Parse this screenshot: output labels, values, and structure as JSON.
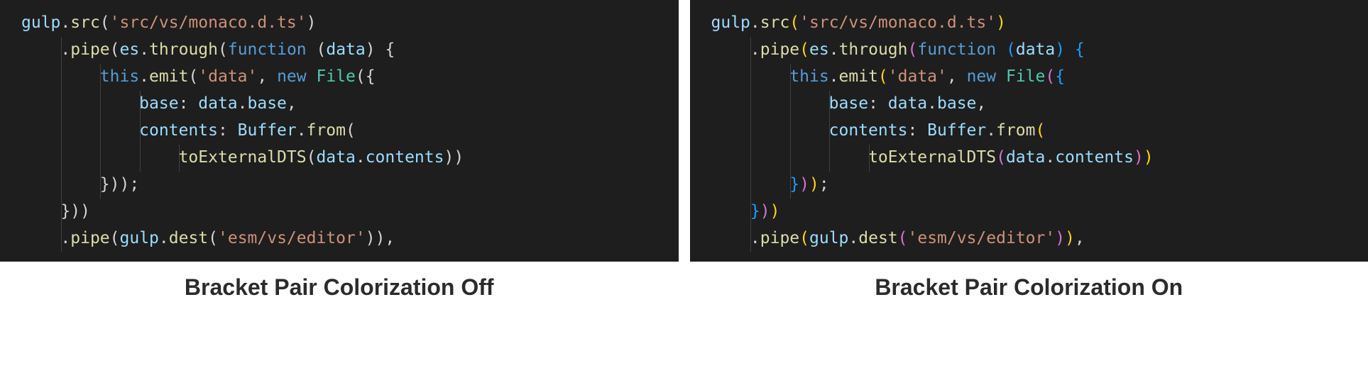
{
  "left": {
    "caption": "Bracket Pair Colorization Off",
    "lines": [
      {
        "indent": 0,
        "tokens": [
          {
            "c": "t-var",
            "t": "gulp"
          },
          {
            "c": "t-punct",
            "t": "."
          },
          {
            "c": "t-func",
            "t": "src"
          },
          {
            "c": "t-bracket",
            "t": "("
          },
          {
            "c": "t-string",
            "t": "'src/vs/monaco.d.ts'"
          },
          {
            "c": "t-bracket",
            "t": ")"
          }
        ]
      },
      {
        "indent": 1,
        "tokens": [
          {
            "c": "t-punct",
            "t": "."
          },
          {
            "c": "t-func",
            "t": "pipe"
          },
          {
            "c": "t-bracket",
            "t": "("
          },
          {
            "c": "t-var",
            "t": "es"
          },
          {
            "c": "t-punct",
            "t": "."
          },
          {
            "c": "t-func",
            "t": "through"
          },
          {
            "c": "t-bracket",
            "t": "("
          },
          {
            "c": "t-keyword",
            "t": "function"
          },
          {
            "c": "t-default",
            "t": " "
          },
          {
            "c": "t-bracket",
            "t": "("
          },
          {
            "c": "t-var",
            "t": "data"
          },
          {
            "c": "t-bracket",
            "t": ")"
          },
          {
            "c": "t-default",
            "t": " "
          },
          {
            "c": "t-bracket",
            "t": "{"
          }
        ]
      },
      {
        "indent": 2,
        "tokens": [
          {
            "c": "t-keyword",
            "t": "this"
          },
          {
            "c": "t-punct",
            "t": "."
          },
          {
            "c": "t-func",
            "t": "emit"
          },
          {
            "c": "t-bracket",
            "t": "("
          },
          {
            "c": "t-string",
            "t": "'data'"
          },
          {
            "c": "t-default",
            "t": ", "
          },
          {
            "c": "t-keyword",
            "t": "new"
          },
          {
            "c": "t-default",
            "t": " "
          },
          {
            "c": "t-class",
            "t": "File"
          },
          {
            "c": "t-bracket",
            "t": "({"
          }
        ]
      },
      {
        "indent": 3,
        "tokens": [
          {
            "c": "t-var",
            "t": "base"
          },
          {
            "c": "t-default",
            "t": ": "
          },
          {
            "c": "t-var",
            "t": "data"
          },
          {
            "c": "t-punct",
            "t": "."
          },
          {
            "c": "t-var",
            "t": "base"
          },
          {
            "c": "t-default",
            "t": ","
          }
        ]
      },
      {
        "indent": 3,
        "tokens": [
          {
            "c": "t-var",
            "t": "contents"
          },
          {
            "c": "t-default",
            "t": ": "
          },
          {
            "c": "t-var",
            "t": "Buffer"
          },
          {
            "c": "t-punct",
            "t": "."
          },
          {
            "c": "t-func",
            "t": "from"
          },
          {
            "c": "t-bracket",
            "t": "("
          }
        ]
      },
      {
        "indent": 4,
        "tokens": [
          {
            "c": "t-func",
            "t": "toExternalDTS"
          },
          {
            "c": "t-bracket",
            "t": "("
          },
          {
            "c": "t-var",
            "t": "data"
          },
          {
            "c": "t-punct",
            "t": "."
          },
          {
            "c": "t-var",
            "t": "contents"
          },
          {
            "c": "t-bracket",
            "t": "))"
          }
        ]
      },
      {
        "indent": 2,
        "tokens": [
          {
            "c": "t-bracket",
            "t": "}))"
          },
          {
            "c": "t-default",
            "t": ";"
          }
        ]
      },
      {
        "indent": 1,
        "tokens": [
          {
            "c": "t-bracket",
            "t": "}))"
          }
        ]
      },
      {
        "indent": 1,
        "tokens": [
          {
            "c": "t-punct",
            "t": "."
          },
          {
            "c": "t-func",
            "t": "pipe"
          },
          {
            "c": "t-bracket",
            "t": "("
          },
          {
            "c": "t-var",
            "t": "gulp"
          },
          {
            "c": "t-punct",
            "t": "."
          },
          {
            "c": "t-func",
            "t": "dest"
          },
          {
            "c": "t-bracket",
            "t": "("
          },
          {
            "c": "t-string",
            "t": "'esm/vs/editor'"
          },
          {
            "c": "t-bracket",
            "t": "))"
          },
          {
            "c": "t-default",
            "t": ","
          }
        ]
      }
    ]
  },
  "right": {
    "caption": "Bracket Pair Colorization On",
    "lines": [
      {
        "indent": 0,
        "tokens": [
          {
            "c": "t-var",
            "t": "gulp"
          },
          {
            "c": "t-punct",
            "t": "."
          },
          {
            "c": "t-func",
            "t": "src"
          },
          {
            "c": "b1",
            "t": "("
          },
          {
            "c": "t-string",
            "t": "'src/vs/monaco.d.ts'"
          },
          {
            "c": "b1",
            "t": ")"
          }
        ]
      },
      {
        "indent": 1,
        "tokens": [
          {
            "c": "t-punct",
            "t": "."
          },
          {
            "c": "t-func",
            "t": "pipe"
          },
          {
            "c": "b1",
            "t": "("
          },
          {
            "c": "t-var",
            "t": "es"
          },
          {
            "c": "t-punct",
            "t": "."
          },
          {
            "c": "t-func",
            "t": "through"
          },
          {
            "c": "b2",
            "t": "("
          },
          {
            "c": "t-keyword",
            "t": "function"
          },
          {
            "c": "t-default",
            "t": " "
          },
          {
            "c": "b3",
            "t": "("
          },
          {
            "c": "t-var",
            "t": "data"
          },
          {
            "c": "b3",
            "t": ")"
          },
          {
            "c": "t-default",
            "t": " "
          },
          {
            "c": "b3",
            "t": "{"
          }
        ]
      },
      {
        "indent": 2,
        "tokens": [
          {
            "c": "t-keyword",
            "t": "this"
          },
          {
            "c": "t-punct",
            "t": "."
          },
          {
            "c": "t-func",
            "t": "emit"
          },
          {
            "c": "b1",
            "t": "("
          },
          {
            "c": "t-string",
            "t": "'data'"
          },
          {
            "c": "t-default",
            "t": ", "
          },
          {
            "c": "t-keyword",
            "t": "new"
          },
          {
            "c": "t-default",
            "t": " "
          },
          {
            "c": "t-class",
            "t": "File"
          },
          {
            "c": "b2",
            "t": "("
          },
          {
            "c": "b3",
            "t": "{"
          }
        ]
      },
      {
        "indent": 3,
        "tokens": [
          {
            "c": "t-var",
            "t": "base"
          },
          {
            "c": "t-default",
            "t": ": "
          },
          {
            "c": "t-var",
            "t": "data"
          },
          {
            "c": "t-punct",
            "t": "."
          },
          {
            "c": "t-var",
            "t": "base"
          },
          {
            "c": "t-default",
            "t": ","
          }
        ]
      },
      {
        "indent": 3,
        "tokens": [
          {
            "c": "t-var",
            "t": "contents"
          },
          {
            "c": "t-default",
            "t": ": "
          },
          {
            "c": "t-var",
            "t": "Buffer"
          },
          {
            "c": "t-punct",
            "t": "."
          },
          {
            "c": "t-func",
            "t": "from"
          },
          {
            "c": "b1",
            "t": "("
          }
        ]
      },
      {
        "indent": 4,
        "tokens": [
          {
            "c": "t-func",
            "t": "toExternalDTS"
          },
          {
            "c": "b2",
            "t": "("
          },
          {
            "c": "t-var",
            "t": "data"
          },
          {
            "c": "t-punct",
            "t": "."
          },
          {
            "c": "t-var",
            "t": "contents"
          },
          {
            "c": "b2",
            "t": ")"
          },
          {
            "c": "b1",
            "t": ")"
          }
        ]
      },
      {
        "indent": 2,
        "tokens": [
          {
            "c": "b3",
            "t": "}"
          },
          {
            "c": "b2",
            "t": ")"
          },
          {
            "c": "b1",
            "t": ")"
          },
          {
            "c": "t-default",
            "t": ";"
          }
        ]
      },
      {
        "indent": 1,
        "tokens": [
          {
            "c": "b3",
            "t": "}"
          },
          {
            "c": "b2",
            "t": ")"
          },
          {
            "c": "b1",
            "t": ")"
          }
        ]
      },
      {
        "indent": 1,
        "tokens": [
          {
            "c": "t-punct",
            "t": "."
          },
          {
            "c": "t-func",
            "t": "pipe"
          },
          {
            "c": "b1",
            "t": "("
          },
          {
            "c": "t-var",
            "t": "gulp"
          },
          {
            "c": "t-punct",
            "t": "."
          },
          {
            "c": "t-func",
            "t": "dest"
          },
          {
            "c": "b2",
            "t": "("
          },
          {
            "c": "t-string",
            "t": "'esm/vs/editor'"
          },
          {
            "c": "b2",
            "t": ")"
          },
          {
            "c": "b1",
            "t": ")"
          },
          {
            "c": "t-default",
            "t": ","
          }
        ]
      }
    ]
  },
  "indentUnit": "    ",
  "guidePositions": [
    60,
    120,
    180,
    240
  ]
}
